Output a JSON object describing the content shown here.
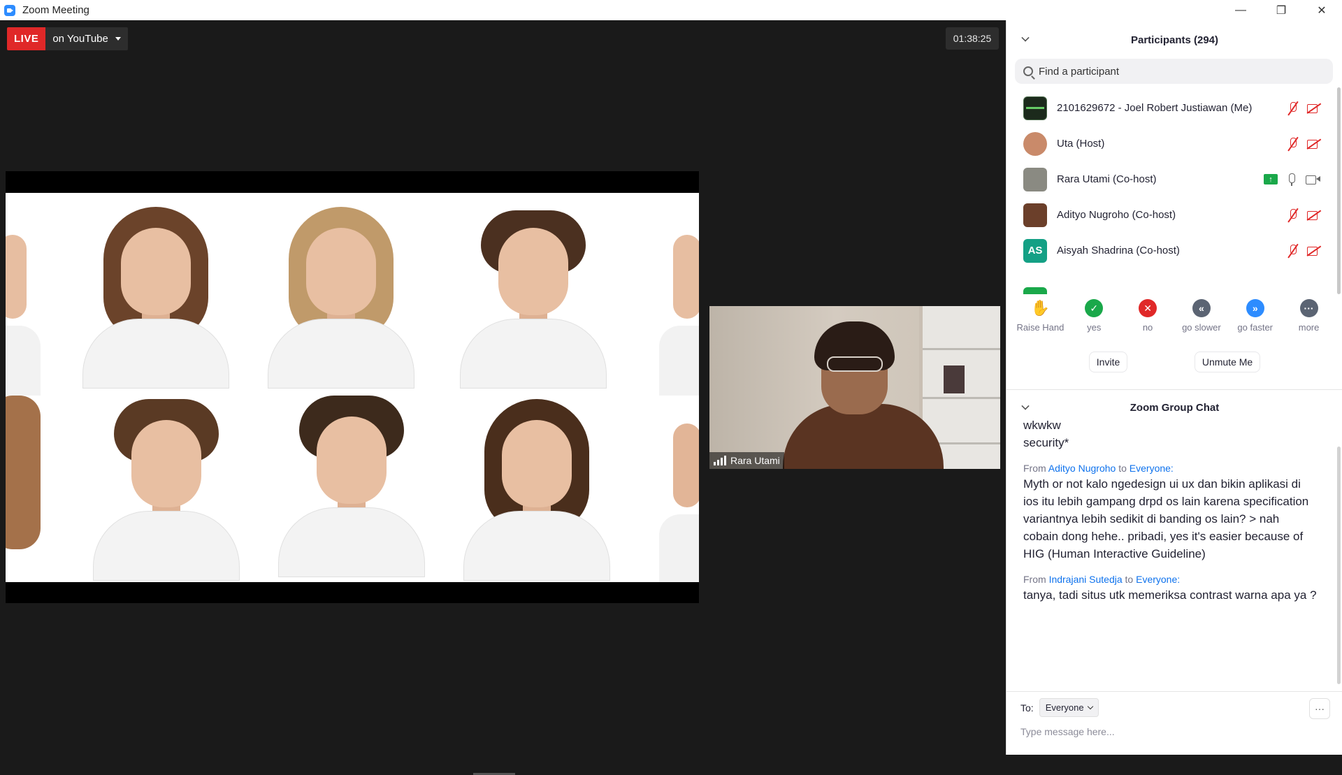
{
  "window": {
    "title": "Zoom Meeting",
    "minimize_glyph": "—",
    "restore_glyph": "❐",
    "close_glyph": "✕"
  },
  "live": {
    "badge": "LIVE",
    "destination": "on YouTube",
    "timer": "01:38:25",
    "badge_color": "#e02828"
  },
  "camera_tile": {
    "name": "Rara Utami"
  },
  "participants": {
    "title": "Participants (294)",
    "search_placeholder": "Find a participant",
    "items": [
      {
        "name": "2101629672 - Joel Robert Justiawan (Me)",
        "avatar_text": "",
        "avatar_color": "#1c2a1c",
        "muted": true,
        "video_off": true
      },
      {
        "name": "Uta (Host)",
        "avatar_text": "",
        "avatar_color": "#c98a6a",
        "muted": true,
        "video_off": true
      },
      {
        "name": "Rara Utami (Co-host)",
        "avatar_text": "",
        "avatar_color": "#8a8a82",
        "muted": false,
        "video_off": false,
        "sharing": true
      },
      {
        "name": "Adityo Nugroho (Co-host)",
        "avatar_text": "",
        "avatar_color": "#6b3f2a",
        "muted": true,
        "video_off": true
      },
      {
        "name": "Aisyah Shadrina (Co-host)",
        "avatar_text": "AS",
        "avatar_color": "#14a085",
        "muted": true,
        "video_off": true
      }
    ]
  },
  "reactions": [
    {
      "label": "Raise Hand",
      "icon": "raise-hand-icon",
      "color": "#2d8cff"
    },
    {
      "label": "yes",
      "icon": "check-icon",
      "color": "#1aa84a"
    },
    {
      "label": "no",
      "icon": "x-icon",
      "color": "#e02828"
    },
    {
      "label": "go slower",
      "icon": "rewind-icon",
      "color": "#5b6473"
    },
    {
      "label": "go faster",
      "icon": "fast-forward-icon",
      "color": "#2d8cff"
    },
    {
      "label": "more",
      "icon": "more-icon",
      "color": "#5b6473"
    }
  ],
  "actions": {
    "invite": "Invite",
    "unmute": "Unmute Me"
  },
  "chat": {
    "title": "Zoom Group Chat",
    "fragment_lines": [
      "wkwkw",
      "security*"
    ],
    "messages": [
      {
        "from_label": "From",
        "sender": "Adityo Nugroho",
        "to_label": "to",
        "recipient": "Everyone:",
        "text": "Myth or not kalo ngedesign ui ux dan bikin aplikasi di ios itu lebih gampang drpd os lain karena specification variantnya lebih sedikit di banding os lain? > nah cobain dong hehe.. pribadi, yes it's easier because of HIG (Human Interactive Guideline)"
      },
      {
        "from_label": "From",
        "sender": "Indrajani Sutedja",
        "to_label": "to",
        "recipient": "Everyone:",
        "text": "tanya, tadi situs utk memeriksa contrast warna apa ya ?"
      }
    ],
    "to_label": "To:",
    "to_value": "Everyone",
    "more_glyph": "···",
    "input_placeholder": "Type message here..."
  }
}
